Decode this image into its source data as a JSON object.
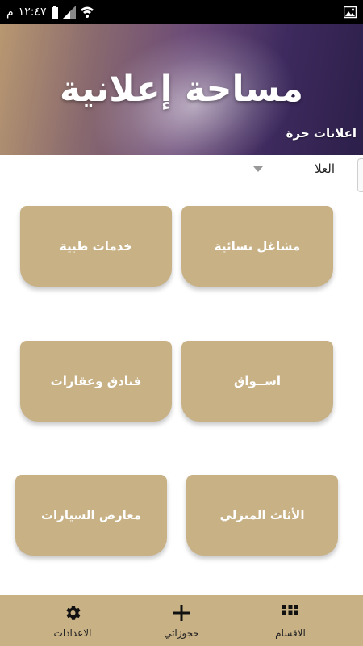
{
  "status_bar": {
    "time": "١٢:٤٧",
    "period": "م"
  },
  "banner": {
    "title": "مساحة إعلانية",
    "subtitle": "اعلانات حرة"
  },
  "sort": {
    "selected": "العلا"
  },
  "categories": [
    {
      "label": "مشاغل نسائية"
    },
    {
      "label": "خدمات طبية"
    },
    {
      "label": "اســواق"
    },
    {
      "label": "فنادق وعقارات"
    },
    {
      "label": "الأثاث المنزلي"
    },
    {
      "label": "معارض السيارات"
    }
  ],
  "bottom_nav": {
    "sections": "الاقسام",
    "bookings": "حجوزاتي",
    "settings": "الاعدادات"
  },
  "colors": {
    "card": "#c8b185",
    "nav": "#c8b185"
  },
  "icons": {
    "sections": "grid-icon",
    "bookings": "plus-icon",
    "settings": "gear-icon"
  }
}
